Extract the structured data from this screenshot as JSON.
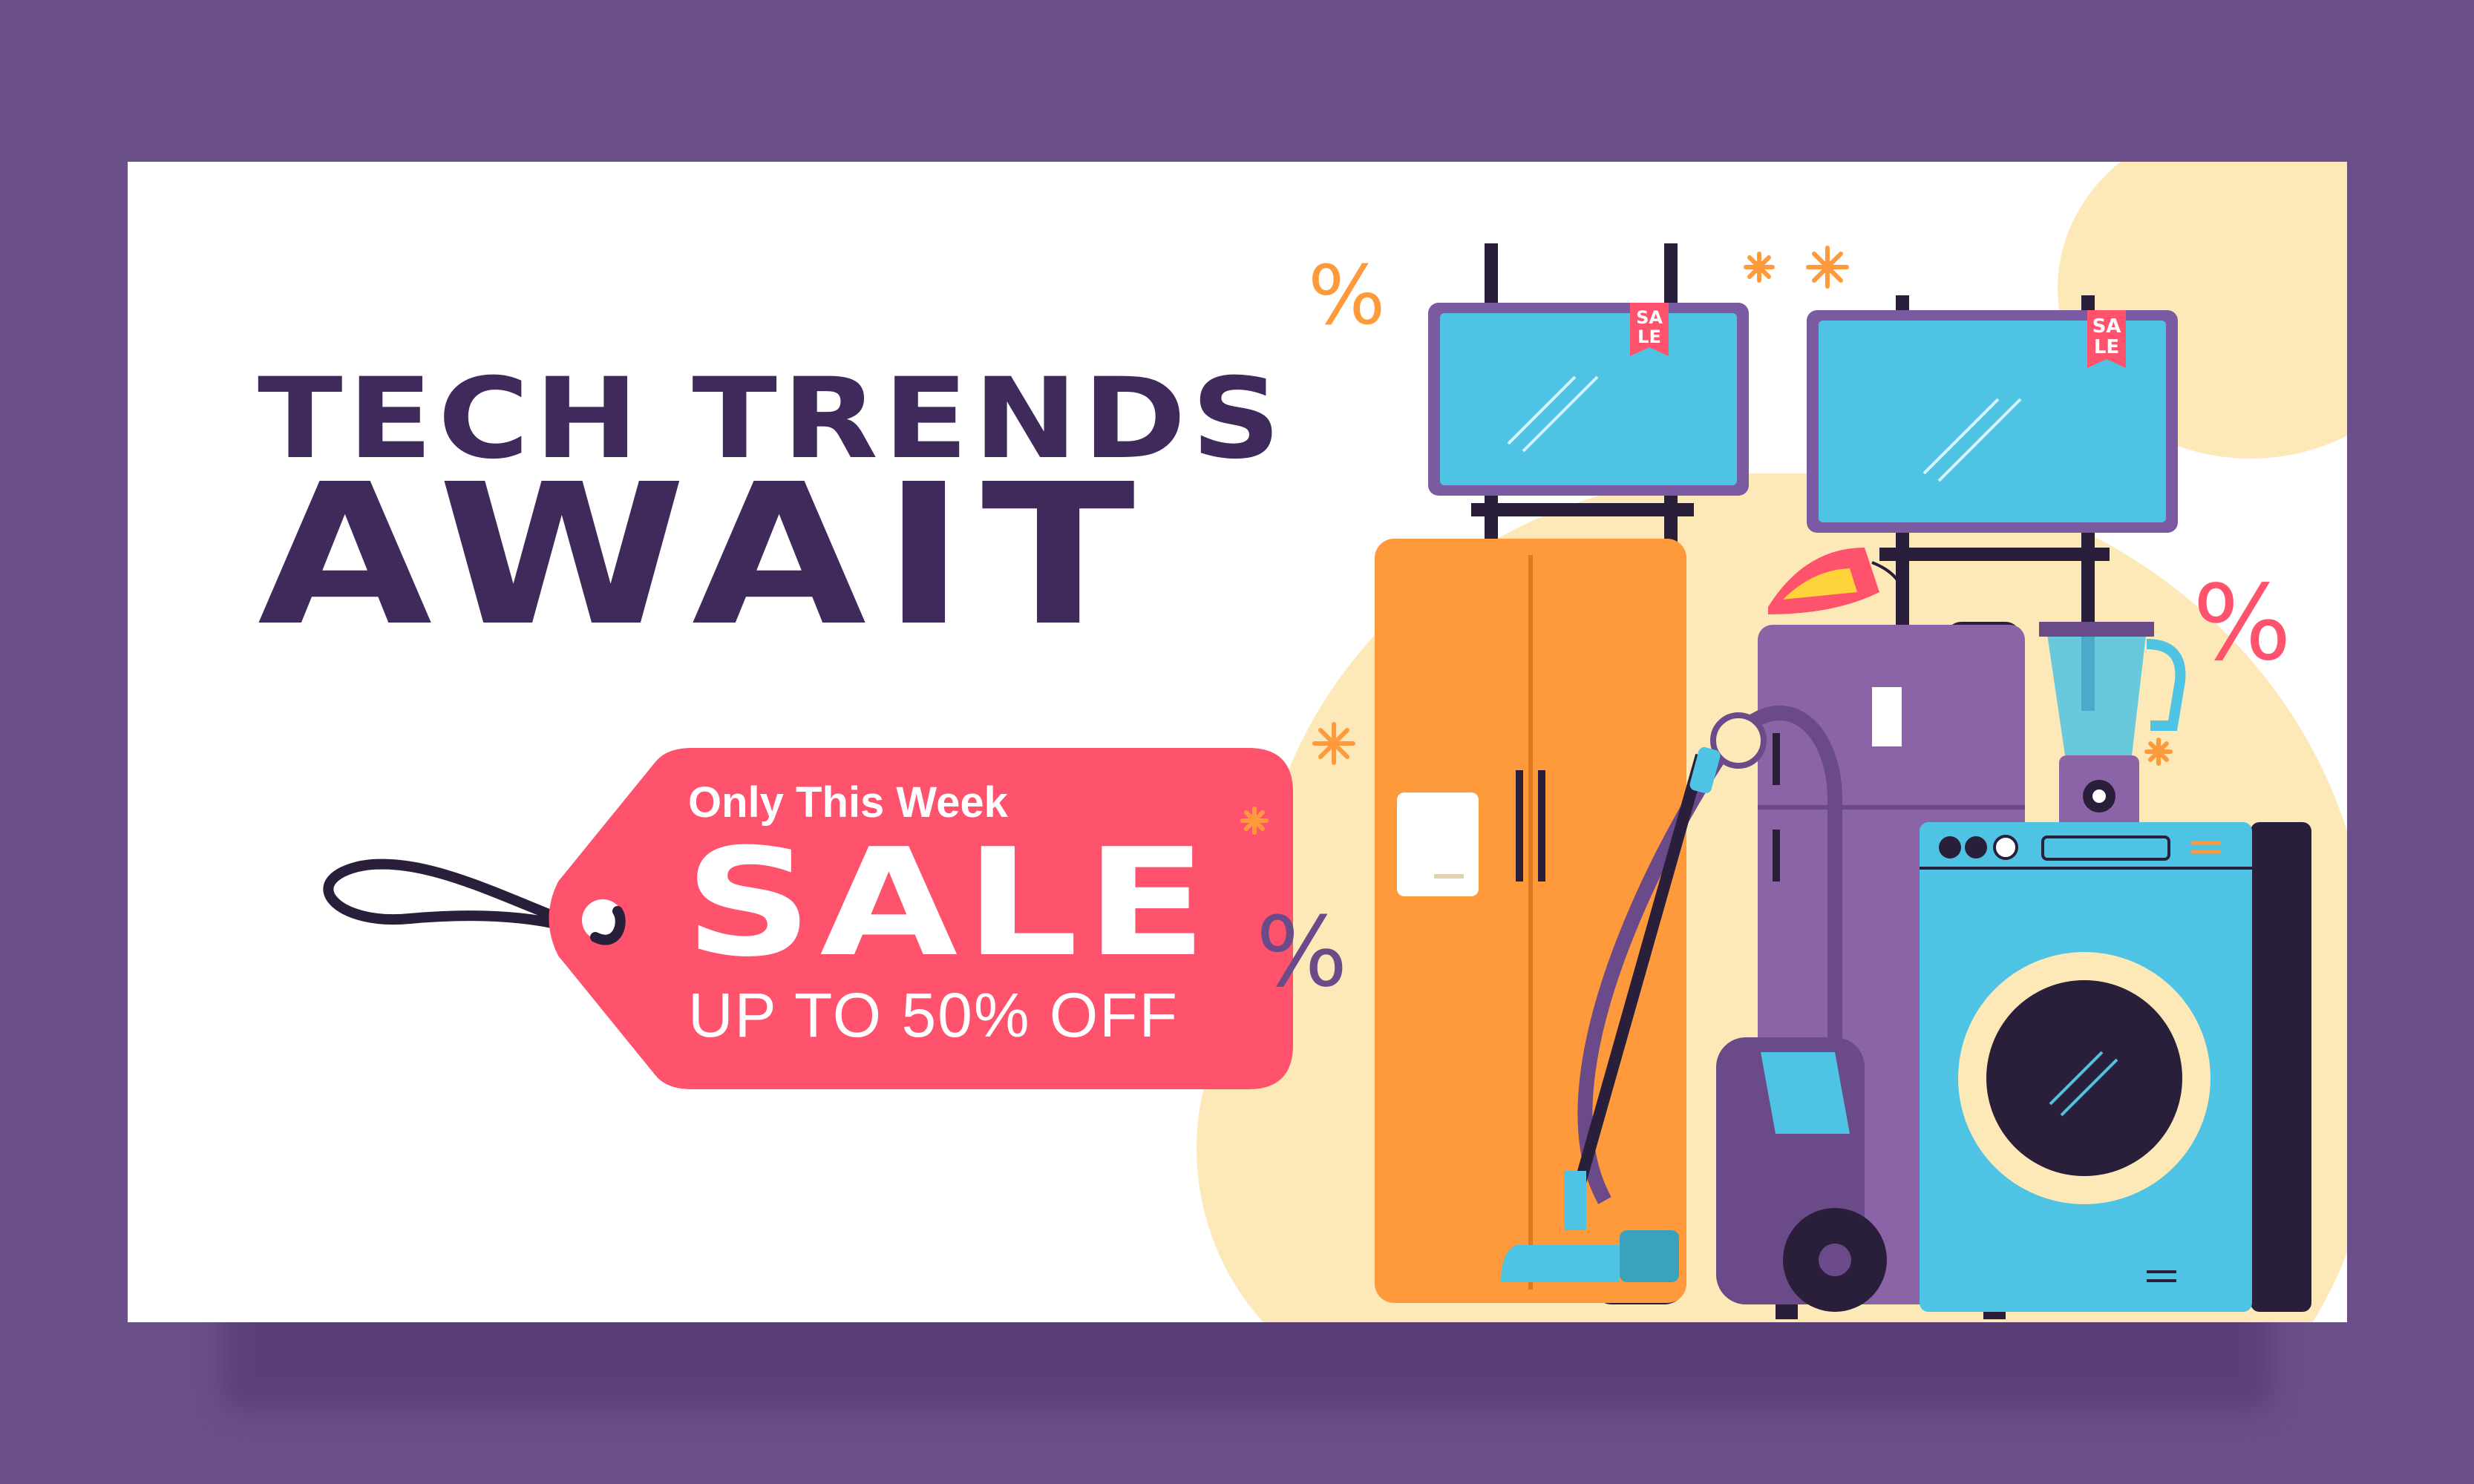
{
  "headline": {
    "line1": "TECH TRENDS",
    "line2": "AWAIT"
  },
  "promo": {
    "subtitle": "Only This Week",
    "title": "SALE",
    "offer": "UP TO 50% OFF"
  },
  "stickers": {
    "tv_left": [
      "SA",
      "LE"
    ],
    "tv_right": [
      "SA",
      "LE"
    ]
  },
  "decorations": {
    "percent_symbol": "%"
  },
  "colors": {
    "frame": "#6b4f88",
    "headline": "#3f2a5b",
    "tag": "#ff526c",
    "cream": "#fde9b7",
    "screen": "#4fc3e3",
    "orange": "#ff9a3c",
    "violet": "#8b64a8"
  }
}
